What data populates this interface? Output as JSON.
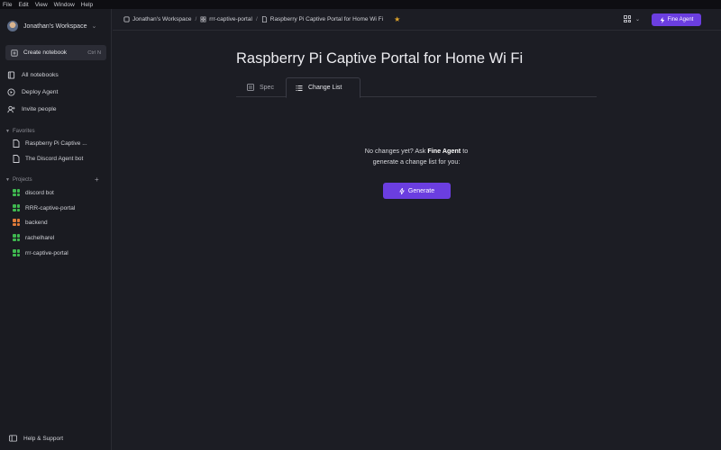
{
  "menubar": [
    "File",
    "Edit",
    "View",
    "Window",
    "Help"
  ],
  "sidebar": {
    "workspace": "Jonathan's Workspace",
    "create": {
      "label": "Create notebook",
      "shortcut": "Ctrl N"
    },
    "nav": [
      "All notebooks",
      "Deploy Agent",
      "Invite people"
    ],
    "favorites_label": "Favorites",
    "favorites": [
      "Raspberry Pi Captive ...",
      "The Discord Agent bot"
    ],
    "projects_label": "Projects",
    "projects": [
      {
        "name": "discord bot",
        "color": "#3fb950"
      },
      {
        "name": "RRR-captive-portal",
        "color": "#3fb950"
      },
      {
        "name": "backend",
        "color": "#e07b39"
      },
      {
        "name": "rachelharel",
        "color": "#3fb950"
      },
      {
        "name": "rrr-captive-portal",
        "color": "#3fb950"
      }
    ],
    "help": "Help & Support"
  },
  "breadcrumb": [
    "Jonathan's Workspace",
    "rrr-captive-portal",
    "Raspberry Pi Captive Portal for Home Wi Fi"
  ],
  "header": {
    "fine_agent": "Fine Agent",
    "accent": "#6b3ee0"
  },
  "page": {
    "title": "Raspberry Pi Captive Portal for Home Wi Fi",
    "tabs": [
      "Spec",
      "Change List"
    ],
    "empty_prefix": "No changes yet? Ask ",
    "empty_agent": "Fine Agent",
    "empty_suffix": " to",
    "empty_line2": "generate a change list for you:",
    "generate": "Generate"
  }
}
